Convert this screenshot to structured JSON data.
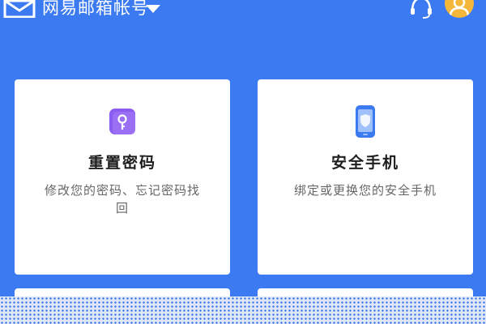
{
  "header": {
    "title": "网易邮箱帐号",
    "icons": [
      "mail-icon",
      "chevron-down-icon",
      "headset-icon",
      "avatar-icon"
    ]
  },
  "cards": [
    {
      "title": "重置密码",
      "description": "修改您的密码、忘记密码找回",
      "icon": "key-icon",
      "icon_color": "#8c5cf0"
    },
    {
      "title": "安全手机",
      "description": "绑定或更换您的安全手机",
      "icon": "phone-shield-icon",
      "icon_color": "#3b7af0"
    }
  ],
  "colors": {
    "background": "#3b7af0",
    "card": "#ffffff",
    "avatar": "#f4b73a"
  }
}
